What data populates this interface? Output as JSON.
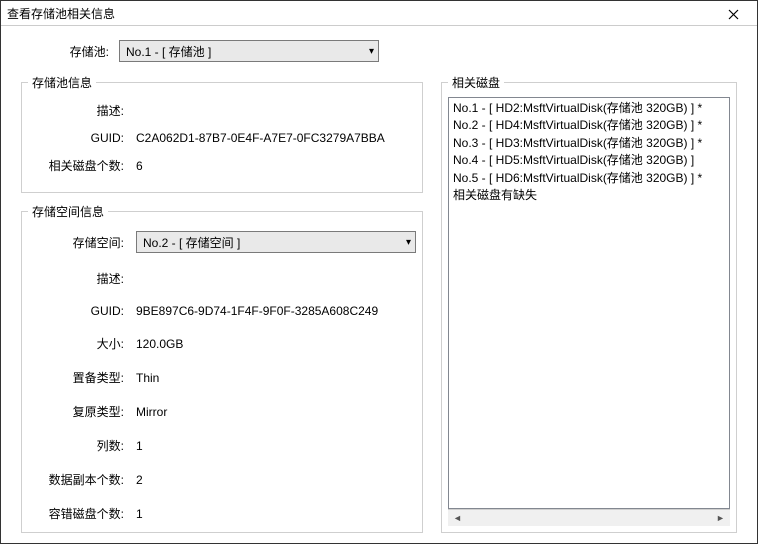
{
  "window": {
    "title": "查看存储池相关信息"
  },
  "pool_selector": {
    "label": "存储池:",
    "value": "No.1 - [ 存储池 ]"
  },
  "pool_info": {
    "legend": "存储池信息",
    "desc_label": "描述:",
    "desc_value": "",
    "guid_label": "GUID:",
    "guid_value": "C2A062D1-87B7-0E4F-A7E7-0FC3279A7BBA",
    "disk_count_label": "相关磁盘个数:",
    "disk_count_value": "6"
  },
  "space_info": {
    "legend": "存储空间信息",
    "space_label": "存储空间:",
    "space_value": "No.2 - [ 存储空间 ]",
    "desc_label": "描述:",
    "desc_value": "",
    "guid_label": "GUID:",
    "guid_value": "9BE897C6-9D74-1F4F-9F0F-3285A608C249",
    "size_label": "大小:",
    "size_value": "120.0GB",
    "provision_label": "置备类型:",
    "provision_value": "Thin",
    "resiliency_label": "复原类型:",
    "resiliency_value": "Mirror",
    "columns_label": "列数:",
    "columns_value": "1",
    "copies_label": "数据副本个数:",
    "copies_value": "2",
    "tolerance_label": "容错磁盘个数:",
    "tolerance_value": "1"
  },
  "disks": {
    "legend": "相关磁盘",
    "items": [
      "No.1 - [ HD2:MsftVirtualDisk(存储池 320GB) ] *",
      "No.2 - [ HD4:MsftVirtualDisk(存储池 320GB) ] *",
      "No.3 - [ HD3:MsftVirtualDisk(存储池 320GB) ] *",
      "No.4 - [ HD5:MsftVirtualDisk(存储池 320GB) ]",
      "No.5 - [ HD6:MsftVirtualDisk(存储池 320GB) ] *"
    ],
    "footer_note": "相关磁盘有缺失"
  }
}
